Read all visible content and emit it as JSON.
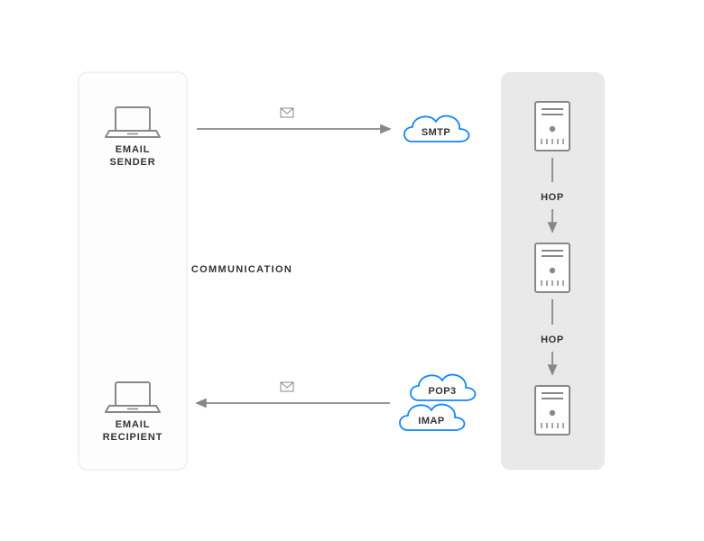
{
  "labels": {
    "sender1": "EMAIL",
    "sender2": "SENDER",
    "recipient1": "EMAIL",
    "recipient2": "RECIPIENT",
    "communication": "COMMUNICATION",
    "hop1": "HOP",
    "hop2": "HOP"
  },
  "protocols": {
    "smtp": "SMTP",
    "pop3": "POP3",
    "imap": "IMAP"
  },
  "colors": {
    "panel_light": "#f7f7f7",
    "panel_light_border": "#eeeeee",
    "panel_dark": "#e8e8e8",
    "stroke": "#888888",
    "text": "#333333",
    "cloud": "#0a84ff"
  }
}
